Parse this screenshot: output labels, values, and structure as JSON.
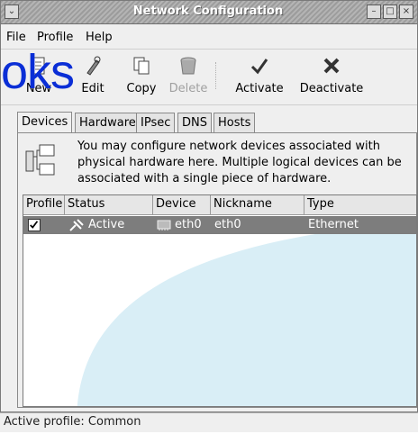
{
  "window": {
    "title": "Network Configuration"
  },
  "overlay": {
    "text": "oks"
  },
  "menubar": {
    "file": "File",
    "profile": "Profile",
    "help": "Help"
  },
  "toolbar": {
    "new_label": "New",
    "edit_label": "Edit",
    "copy_label": "Copy",
    "delete_label": "Delete",
    "activate_label": "Activate",
    "deactivate_label": "Deactivate"
  },
  "tabs": [
    {
      "label": "Devices",
      "active": true
    },
    {
      "label": "Hardware",
      "active": false
    },
    {
      "label": "IPsec",
      "active": false
    },
    {
      "label": "DNS",
      "active": false
    },
    {
      "label": "Hosts",
      "active": false
    }
  ],
  "info": {
    "text": "You may configure network devices associated with physical hardware here.  Multiple logical devices can be associated with a single piece of hardware."
  },
  "table": {
    "columns": [
      "Profile",
      "Status",
      "Device",
      "Nickname",
      "Type"
    ],
    "rows": [
      {
        "profile_checked": true,
        "status": "Active",
        "device": "eth0",
        "nickname": "eth0",
        "type": "Ethernet"
      }
    ]
  },
  "statusbar": {
    "text": "Active profile: Common"
  },
  "colors": {
    "selected_row": "#7d7d7d",
    "overlay_text": "#0a2ed6",
    "list_wave": "#d9eef6"
  }
}
